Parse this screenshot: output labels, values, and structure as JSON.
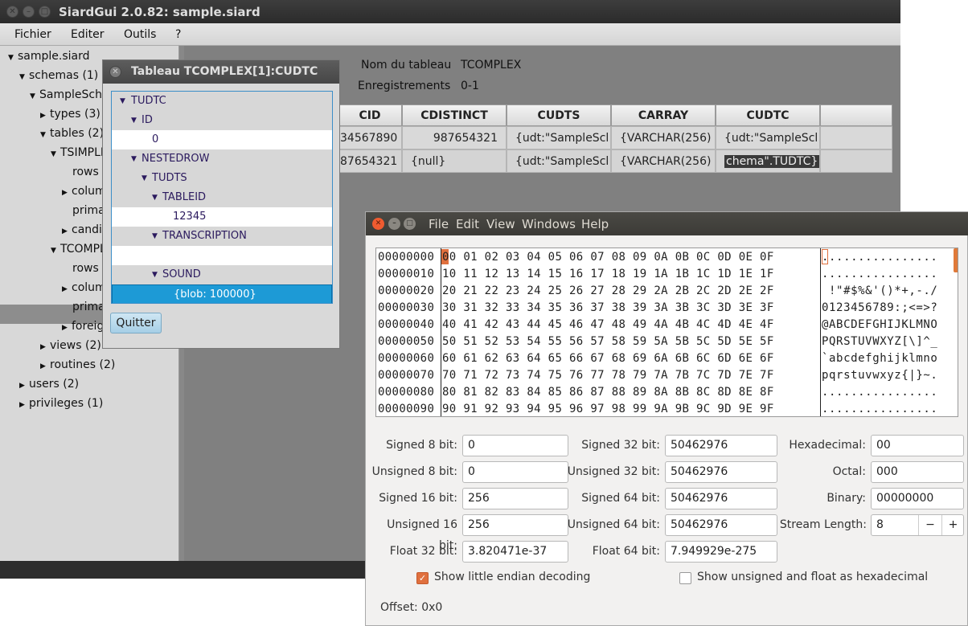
{
  "siard": {
    "title": "SiardGui 2.0.82: sample.siard",
    "menu": [
      "Fichier",
      "Editer",
      "Outils",
      "?"
    ],
    "tree": [
      {
        "label": "sample.siard",
        "expanded": true
      },
      {
        "label": "schemas (1)",
        "expanded": true
      },
      {
        "label": "SampleSche",
        "expanded": true
      },
      {
        "label": "types (3)",
        "expanded": false
      },
      {
        "label": "tables (2)",
        "expanded": true
      },
      {
        "label": "TSIMPLE",
        "expanded": true
      },
      {
        "label": "rows (",
        "expanded": null
      },
      {
        "label": "colum",
        "expanded": false
      },
      {
        "label": "prima",
        "expanded": null
      },
      {
        "label": "candi",
        "expanded": false
      },
      {
        "label": "TCOMPL",
        "expanded": true
      },
      {
        "label": "rows (",
        "expanded": null
      },
      {
        "label": "colum",
        "expanded": false
      },
      {
        "label": "prima",
        "expanded": null
      },
      {
        "label": "foreig",
        "expanded": false
      },
      {
        "label": "views (2)",
        "expanded": false
      },
      {
        "label": "routines (2)",
        "expanded": false
      },
      {
        "label": "users (2)",
        "expanded": false
      },
      {
        "label": "privileges (1)",
        "expanded": false
      }
    ],
    "info": {
      "name_label": "Nom du tableau",
      "name_value": "TCOMPLEX",
      "records_label": "Enregistrements",
      "records_value": "0-1"
    },
    "table": {
      "columns": [
        "CID",
        "CDISTINCT",
        "CUDTS",
        "CARRAY",
        "CUDTC"
      ],
      "rows": [
        [
          "34567890",
          "987654321",
          "{udt:\"SampleScl",
          "{VARCHAR(256)",
          "{udt:\"SampleScl"
        ],
        [
          "87654321",
          "{null}",
          "{udt:\"SampleScl",
          "{VARCHAR(256)",
          "chema\".TUDTC}"
        ]
      ]
    }
  },
  "dialog": {
    "title": "Tableau TCOMPLEX[1]:CUDTC",
    "rows": [
      {
        "label": "TUDTC",
        "style": "gray",
        "arrow": true
      },
      {
        "label": "ID",
        "style": "gray",
        "arrow": true
      },
      {
        "label": "0",
        "style": "white",
        "arrow": false
      },
      {
        "label": "NESTEDROW",
        "style": "gray",
        "arrow": true
      },
      {
        "label": "TUDTS",
        "style": "gray",
        "arrow": true
      },
      {
        "label": "TABLEID",
        "style": "gray",
        "arrow": true
      },
      {
        "label": "12345",
        "style": "white",
        "arrow": false
      },
      {
        "label": "TRANSCRIPTION",
        "style": "gray",
        "arrow": true
      },
      {
        "label": "",
        "style": "white",
        "arrow": false
      },
      {
        "label": "SOUND",
        "style": "gray",
        "arrow": true
      },
      {
        "label": "{blob: 100000}",
        "style": "selected",
        "arrow": false
      }
    ],
    "quit_label": "Quitter"
  },
  "hexwin": {
    "menu": [
      "File",
      "Edit",
      "View",
      "Windows",
      "Help"
    ],
    "rows": [
      {
        "addr": "00000000",
        "bytes": "00 01 02 03 04 05 06 07 08 09 0A 0B 0C 0D 0E 0F",
        "ascii": "................"
      },
      {
        "addr": "00000010",
        "bytes": "10 11 12 13 14 15 16 17 18 19 1A 1B 1C 1D 1E 1F",
        "ascii": "................"
      },
      {
        "addr": "00000020",
        "bytes": "20 21 22 23 24 25 26 27 28 29 2A 2B 2C 2D 2E 2F",
        "ascii": " !\"#$%&'()*+,-./"
      },
      {
        "addr": "00000030",
        "bytes": "30 31 32 33 34 35 36 37 38 39 3A 3B 3C 3D 3E 3F",
        "ascii": "0123456789:;<=>?"
      },
      {
        "addr": "00000040",
        "bytes": "40 41 42 43 44 45 46 47 48 49 4A 4B 4C 4D 4E 4F",
        "ascii": "@ABCDEFGHIJKLMNO"
      },
      {
        "addr": "00000050",
        "bytes": "50 51 52 53 54 55 56 57 58 59 5A 5B 5C 5D 5E 5F",
        "ascii": "PQRSTUVWXYZ[\\]^_"
      },
      {
        "addr": "00000060",
        "bytes": "60 61 62 63 64 65 66 67 68 69 6A 6B 6C 6D 6E 6F",
        "ascii": "`abcdefghijklmno"
      },
      {
        "addr": "00000070",
        "bytes": "70 71 72 73 74 75 76 77 78 79 7A 7B 7C 7D 7E 7F",
        "ascii": "pqrstuvwxyz{|}~."
      },
      {
        "addr": "00000080",
        "bytes": "80 81 82 83 84 85 86 87 88 89 8A 8B 8C 8D 8E 8F",
        "ascii": "................"
      },
      {
        "addr": "00000090",
        "bytes": "90 91 92 93 94 95 96 97 98 99 9A 9B 9C 9D 9E 9F",
        "ascii": "................"
      }
    ],
    "fields": {
      "signed8": {
        "label": "Signed 8 bit:",
        "value": "0"
      },
      "unsigned8": {
        "label": "Unsigned 8 bit:",
        "value": "0"
      },
      "signed16": {
        "label": "Signed 16 bit:",
        "value": "256"
      },
      "unsigned16": {
        "label": "Unsigned 16 bit:",
        "value": "256"
      },
      "float32": {
        "label": "Float 32 bit:",
        "value": "3.820471e-37"
      },
      "signed32": {
        "label": "Signed 32 bit:",
        "value": "50462976"
      },
      "unsigned32": {
        "label": "Unsigned 32 bit:",
        "value": "50462976"
      },
      "signed64": {
        "label": "Signed 64 bit:",
        "value": "50462976"
      },
      "unsigned64": {
        "label": "Unsigned 64 bit:",
        "value": "50462976"
      },
      "float64": {
        "label": "Float 64 bit:",
        "value": "7.949929e-275"
      },
      "hex": {
        "label": "Hexadecimal:",
        "value": "00"
      },
      "octal": {
        "label": "Octal:",
        "value": "000"
      },
      "binary": {
        "label": "Binary:",
        "value": "00000000"
      },
      "stream": {
        "label": "Stream Length:",
        "value": "8",
        "minus": "−",
        "plus": "+"
      }
    },
    "checkboxes": {
      "little_endian": {
        "label": "Show little endian decoding",
        "checked": true
      },
      "unsigned_hex": {
        "label": "Show unsigned and float as hexadecimal",
        "checked": false
      }
    },
    "offset": "Offset: 0x0"
  },
  "colors": {
    "accent": "#e0703e",
    "selection": "#1d9ad6"
  }
}
